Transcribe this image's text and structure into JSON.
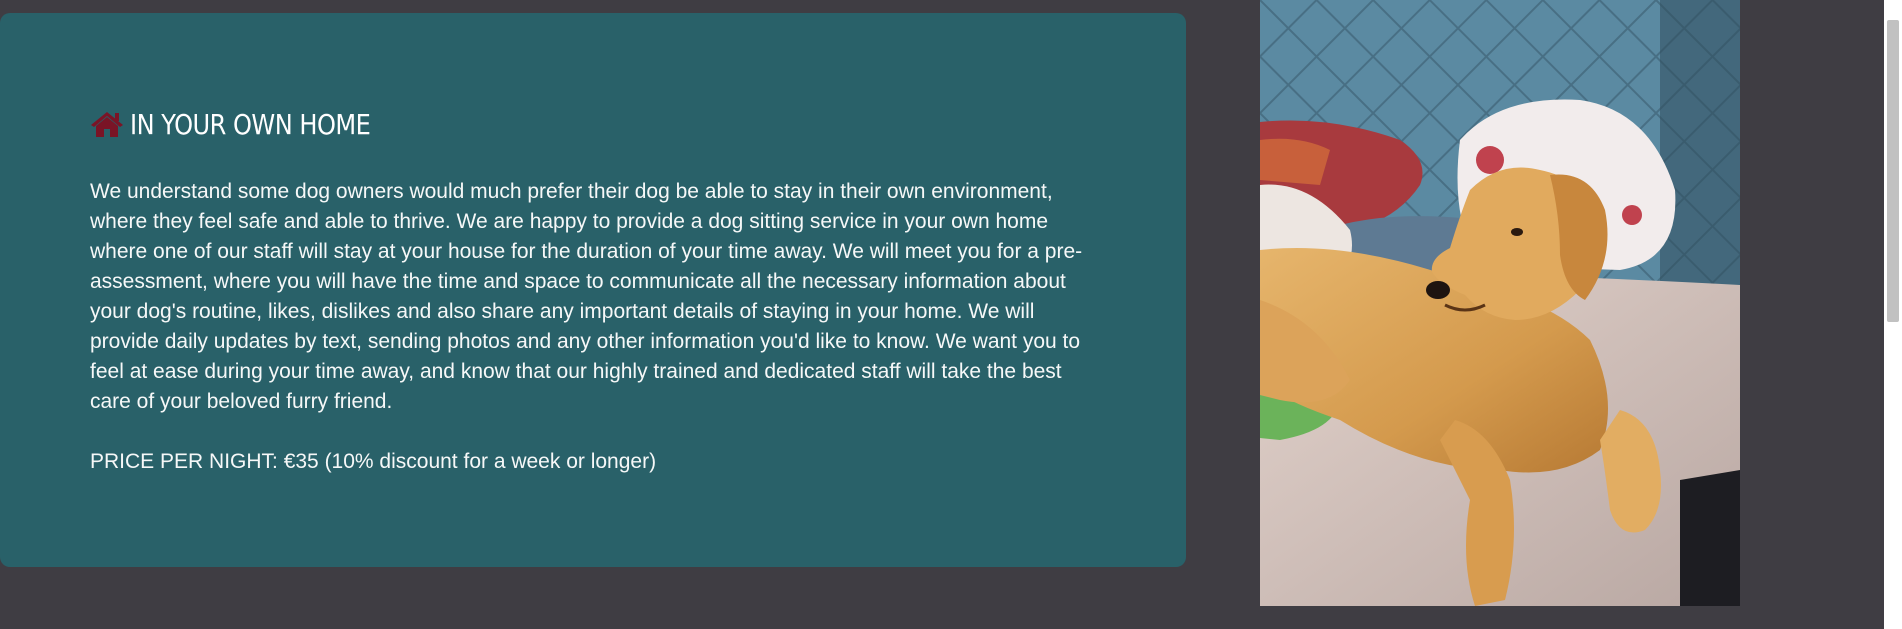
{
  "section": {
    "icon": "house-icon",
    "title": "IN YOUR OWN HOME",
    "description": "We understand some dog owners would much prefer their dog be able to stay in their own environment, where they feel safe and able to thrive. We are happy to provide a dog sitting service in your own home where one of our staff will stay at your house for the duration of your time away. We will meet you for a pre-assessment, where you will have the time and space to communicate all the necessary information about your dog's routine, likes, dislikes and also share any important details of staying in your home. We will provide daily updates by text, sending photos and any other information you'd like to know. We want you to feel at ease during your time away, and know that our highly trained and dedicated staff will take the best care of your beloved furry friend.",
    "price": "PRICE PER NIGHT: €35 (10% discount for a week or longer)"
  },
  "photo": {
    "subject": "golden retriever lying on a bed"
  },
  "colors": {
    "page_background": "#3f3d43",
    "card_background": "#296169",
    "icon_color": "#7a1426",
    "text_color": "#ffffff"
  }
}
